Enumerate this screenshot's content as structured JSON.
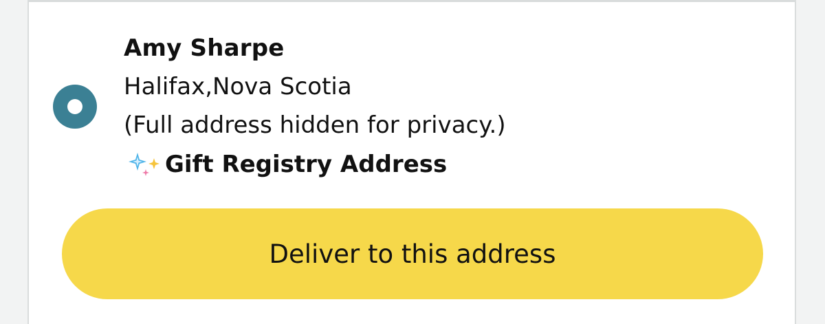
{
  "address": {
    "name": "Amy Sharpe",
    "city_line": "Halifax,Nova Scotia",
    "privacy_note": "(Full address hidden for privacy.)",
    "registry_label": "Gift Registry Address",
    "registry_icon": "sparkles-icon",
    "selected": true
  },
  "actions": {
    "deliver_label": "Deliver to this address"
  },
  "colors": {
    "radio_selected": "#3b8094",
    "button_bg": "#f6d84a",
    "card_border": "#d9dcdc"
  }
}
